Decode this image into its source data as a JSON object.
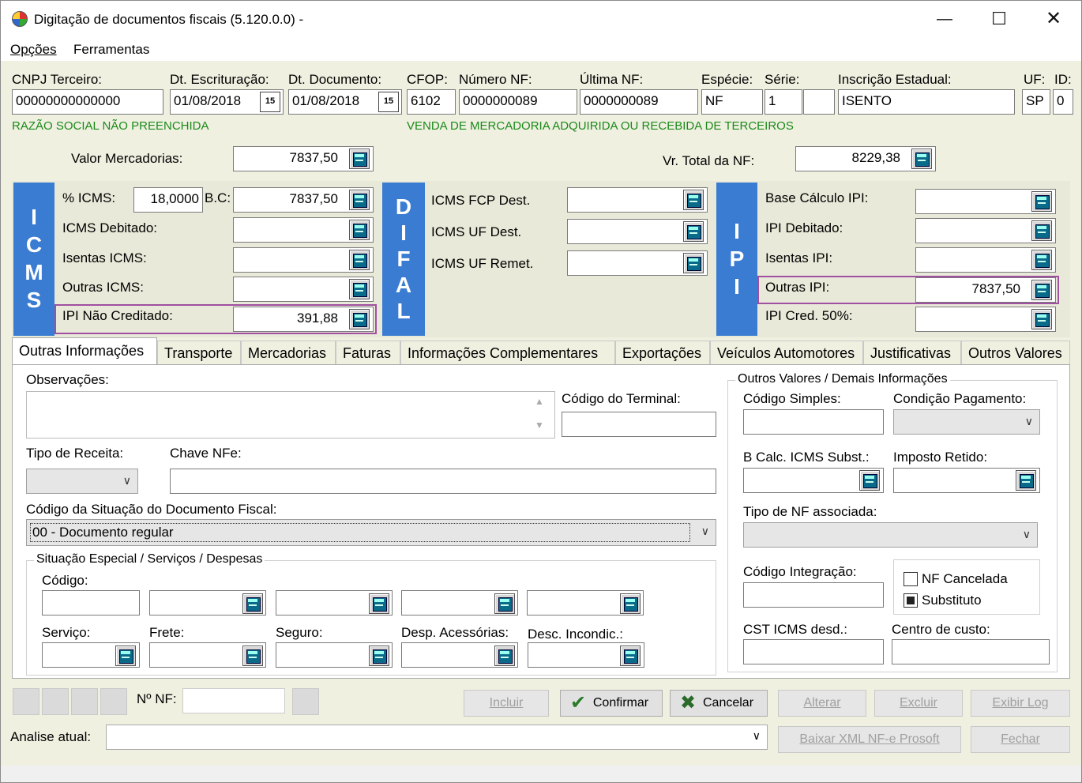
{
  "window": {
    "title": "Digitação de documentos fiscais (5.120.0.0) -"
  },
  "menu": {
    "opcoes": "Opções",
    "ferramentas": "Ferramentas"
  },
  "header": {
    "cnpj_label": "CNPJ Terceiro:",
    "cnpj_value": "00000000000000",
    "dt_escr_label": "Dt. Escrituração:",
    "dt_escr_value": "01/08/2018",
    "dt_doc_label": "Dt. Documento:",
    "dt_doc_value": "01/08/2018",
    "cfop_label": "CFOP:",
    "cfop_value": "6102",
    "numero_label": "Número NF:",
    "numero_value": "0000000089",
    "ultima_label": "Última NF:",
    "ultima_value": "0000000089",
    "especie_label": "Espécie:",
    "especie_value": "NF",
    "serie_label": "Série:",
    "serie_value": "1",
    "ie_label": "Inscrição Estadual:",
    "ie_value": "ISENTO",
    "uf_label": "UF:",
    "uf_value": "SP",
    "id_label": "ID:",
    "id_value": "0",
    "razao_msg": "RAZÃO SOCIAL NÃO PREENCHIDA",
    "cfop_msg": "VENDA DE MERCADORIA ADQUIRIDA OU RECEBIDA DE TERCEIROS",
    "calendar_glyph": "15"
  },
  "totals": {
    "valor_merc_label": "Valor Mercadorias:",
    "valor_merc_value": "7837,50",
    "vr_total_label": "Vr. Total da NF:",
    "vr_total_value": "8229,38"
  },
  "icms": {
    "bar_letters": [
      "I",
      "C",
      "M",
      "S"
    ],
    "pct_label": "% ICMS:",
    "pct_value": "18,0000",
    "bc_label": "B.C:",
    "bc_value": "7837,50",
    "debitado_label": "ICMS Debitado:",
    "debitado_value": "",
    "isentas_label": "Isentas ICMS:",
    "isentas_value": "",
    "outras_label": "Outras ICMS:",
    "outras_value": "",
    "ipi_nao_label": "IPI Não Creditado:",
    "ipi_nao_value": "391,88"
  },
  "difal": {
    "bar_letters": [
      "D",
      "I",
      "F",
      "A",
      "L"
    ],
    "fcp_label": "ICMS FCP Dest.",
    "uf_dest_label": "ICMS UF Dest.",
    "uf_remet_label": "ICMS UF Remet."
  },
  "ipi": {
    "bar_letters": [
      "I",
      "P",
      "I"
    ],
    "base_label": "Base Cálculo IPI:",
    "debitado_label": "IPI Debitado:",
    "isentas_label": "Isentas IPI:",
    "outras_label": "Outras IPI:",
    "outras_value": "7837,50",
    "cred50_label": "IPI Cred. 50%:"
  },
  "tabs": [
    "Outras Informações",
    "Transporte",
    "Mercadorias",
    "Faturas",
    "Informações Complementares",
    "Exportações",
    "Veículos Automotores",
    "Justificativas",
    "Outros Valores"
  ],
  "outras": {
    "obs_label": "Observações:",
    "terminal_label": "Código do Terminal:",
    "tipo_receita_label": "Tipo de Receita:",
    "chave_label": "Chave NFe:",
    "situacao_label": "Código da Situação do Documento Fiscal:",
    "situacao_value": "00 - Documento regular",
    "especial_group": "Situação Especial / Serviços / Despesas",
    "codigo_label": "Código:",
    "servico_label": "Serviço:",
    "frete_label": "Frete:",
    "seguro_label": "Seguro:",
    "desp_label": "Desp. Acessórias:",
    "desc_label": "Desc. Incondic.:",
    "outros_group": "Outros Valores / Demais Informações",
    "cod_simples_label": "Código Simples:",
    "cond_pag_label": "Condição Pagamento:",
    "bcalc_label": "B Calc. ICMS Subst.:",
    "imposto_label": "Imposto Retido:",
    "tipo_nf_label": "Tipo de NF associada:",
    "cod_integ_label": "Código Integração:",
    "nf_cancelada_label": "NF Cancelada",
    "substituto_label": "Substituto",
    "cst_label": "CST ICMS desd.:",
    "centro_label": "Centro de custo:"
  },
  "footer": {
    "nnf_label": "Nº NF:",
    "incluir": "Incluir",
    "confirmar": "Confirmar",
    "cancelar": "Cancelar",
    "alterar": "Alterar",
    "excluir": "Excluir",
    "exibir_log": "Exibir Log",
    "analise_label": "Analise atual:",
    "baixar_xml": "Baixar XML NF-e Prosoft",
    "fechar": "Fechar"
  }
}
